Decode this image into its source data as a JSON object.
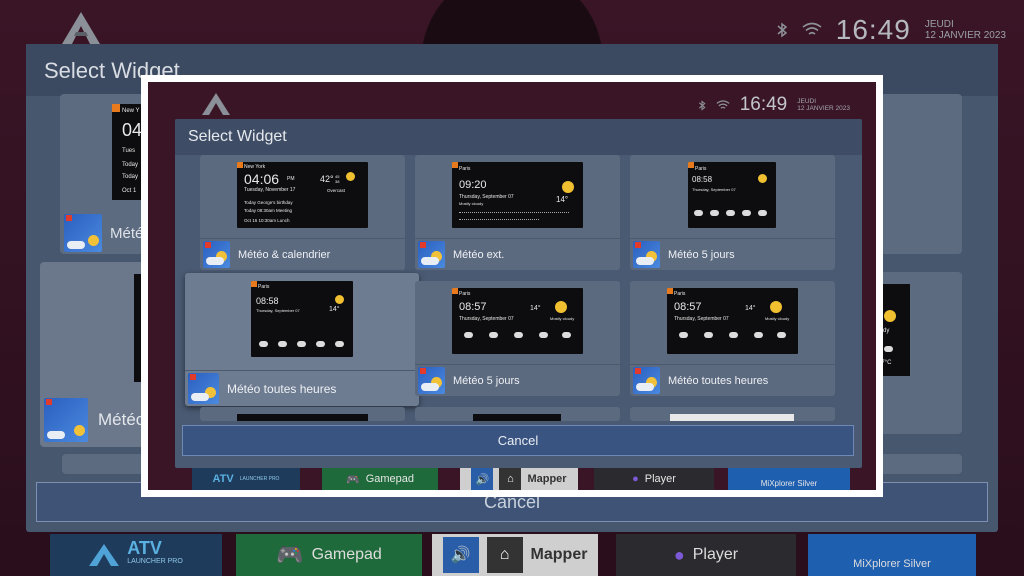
{
  "status": {
    "time": "16:49",
    "day": "JEUDI",
    "date": "12 JANVIER 2023"
  },
  "dialog": {
    "title": "Select Widget",
    "cancel_label": "Cancel"
  },
  "widgets": [
    {
      "label": "Météo & calendrier",
      "selected": false
    },
    {
      "label": "Météo ext.",
      "selected": false
    },
    {
      "label": "Météo 5 jours",
      "selected": false
    },
    {
      "label": "Météo toutes heures",
      "selected": true
    },
    {
      "label": "Météo 5 jours",
      "selected": false
    },
    {
      "label": "Météo toutes heures",
      "selected": false
    }
  ],
  "previews": {
    "cal": {
      "city": "New York",
      "time": "04:06",
      "ampm": "PM",
      "temp": "42°",
      "hi": "45",
      "lo": "38",
      "date": "Tuesday, November 17",
      "cond": "Overcast",
      "rows": [
        "Today    George's birthday",
        "Today    08:30am  Meeting",
        "Oct 16   10:30am  Lunch"
      ]
    },
    "ext": {
      "city": "Paris",
      "time": "09:20",
      "date": "Thursday, September 07",
      "cond": "Mostly cloudy",
      "temp": "14°"
    },
    "five": {
      "city": "Paris",
      "time": "08:58",
      "date": "Thursday, September 07"
    },
    "hourly_sel": {
      "city": "Paris",
      "time": "08:58",
      "date": "Thursday, September 07",
      "temp": "14°"
    },
    "five2": {
      "city": "Paris",
      "time": "08:57",
      "date": "Thursday, September 07",
      "cond": "Mostly cloudy",
      "temp": "14°"
    },
    "hourly2": {
      "city": "Paris",
      "time": "08:57",
      "date": "Thursday, September 07",
      "cond": "Mostly cloudy",
      "temp": "14°"
    }
  },
  "background": {
    "title": "Select Widget",
    "cancel_label": "Cancel",
    "partial_labels": [
      "Météo",
      "Météo"
    ],
    "partial_city": "New Y",
    "partial_time": "04",
    "partial_rows": [
      "Tues",
      "Today",
      "Today",
      "Oct 1"
    ],
    "partial_right": [
      "cloudy",
      "17°C"
    ]
  },
  "dock": {
    "launcher_name": "ATV",
    "launcher_sub": "LAUNCHER PRO",
    "gamepad": "Gamepad",
    "mapper": "Mapper",
    "player": "Player",
    "mixplorer": "MiXplorer Silver"
  },
  "colors": {
    "accent": "#3a5481",
    "dialog": "#4a5a72",
    "header": "#3e4d65",
    "card": "#5c6a80",
    "wallpaper": "#3a1526"
  }
}
